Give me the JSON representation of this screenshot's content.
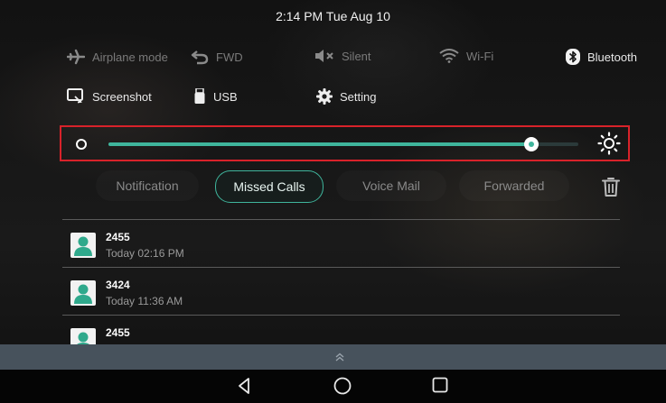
{
  "status_bar": {
    "datetime": "2:14 PM Tue Aug 10"
  },
  "quick_settings": {
    "airplane_mode": {
      "label": "Airplane mode",
      "icon": "airplane-icon",
      "enabled": false
    },
    "fwd": {
      "label": "FWD",
      "icon": "forward-icon",
      "enabled": false
    },
    "silent": {
      "label": "Silent",
      "icon": "mute-icon",
      "enabled": false
    },
    "wifi": {
      "label": "Wi-Fi",
      "icon": "wifi-icon",
      "enabled": false
    },
    "bluetooth": {
      "label": "Bluetooth",
      "icon": "bluetooth-icon",
      "enabled": true
    },
    "screenshot": {
      "label": "Screenshot",
      "icon": "screenshot-icon"
    },
    "usb": {
      "label": "USB",
      "icon": "usb-icon"
    },
    "setting": {
      "label": "Setting",
      "icon": "gear-icon"
    }
  },
  "brightness": {
    "level_percent": 90,
    "accent": "#3fb59c",
    "highlight_border": "#d8222a"
  },
  "tabs": [
    {
      "label": "Notification",
      "active": false
    },
    {
      "label": "Missed Calls",
      "active": true
    },
    {
      "label": "Voice Mail",
      "active": false
    },
    {
      "label": "Forwarded",
      "active": false
    }
  ],
  "delete": {
    "icon": "trash-icon"
  },
  "missed_calls": [
    {
      "number": "2455",
      "time": "Today 02:16 PM"
    },
    {
      "number": "3424",
      "time": "Today 11:36 AM"
    },
    {
      "number": "2455",
      "time": ""
    }
  ],
  "colors": {
    "accent": "#3fb59c",
    "avatar": "#2fa98c",
    "bottom_bar": "#47525c"
  },
  "nav": {
    "back_icon": "back-triangle-icon",
    "home_icon": "home-circle-icon",
    "recents_icon": "recents-square-icon"
  }
}
